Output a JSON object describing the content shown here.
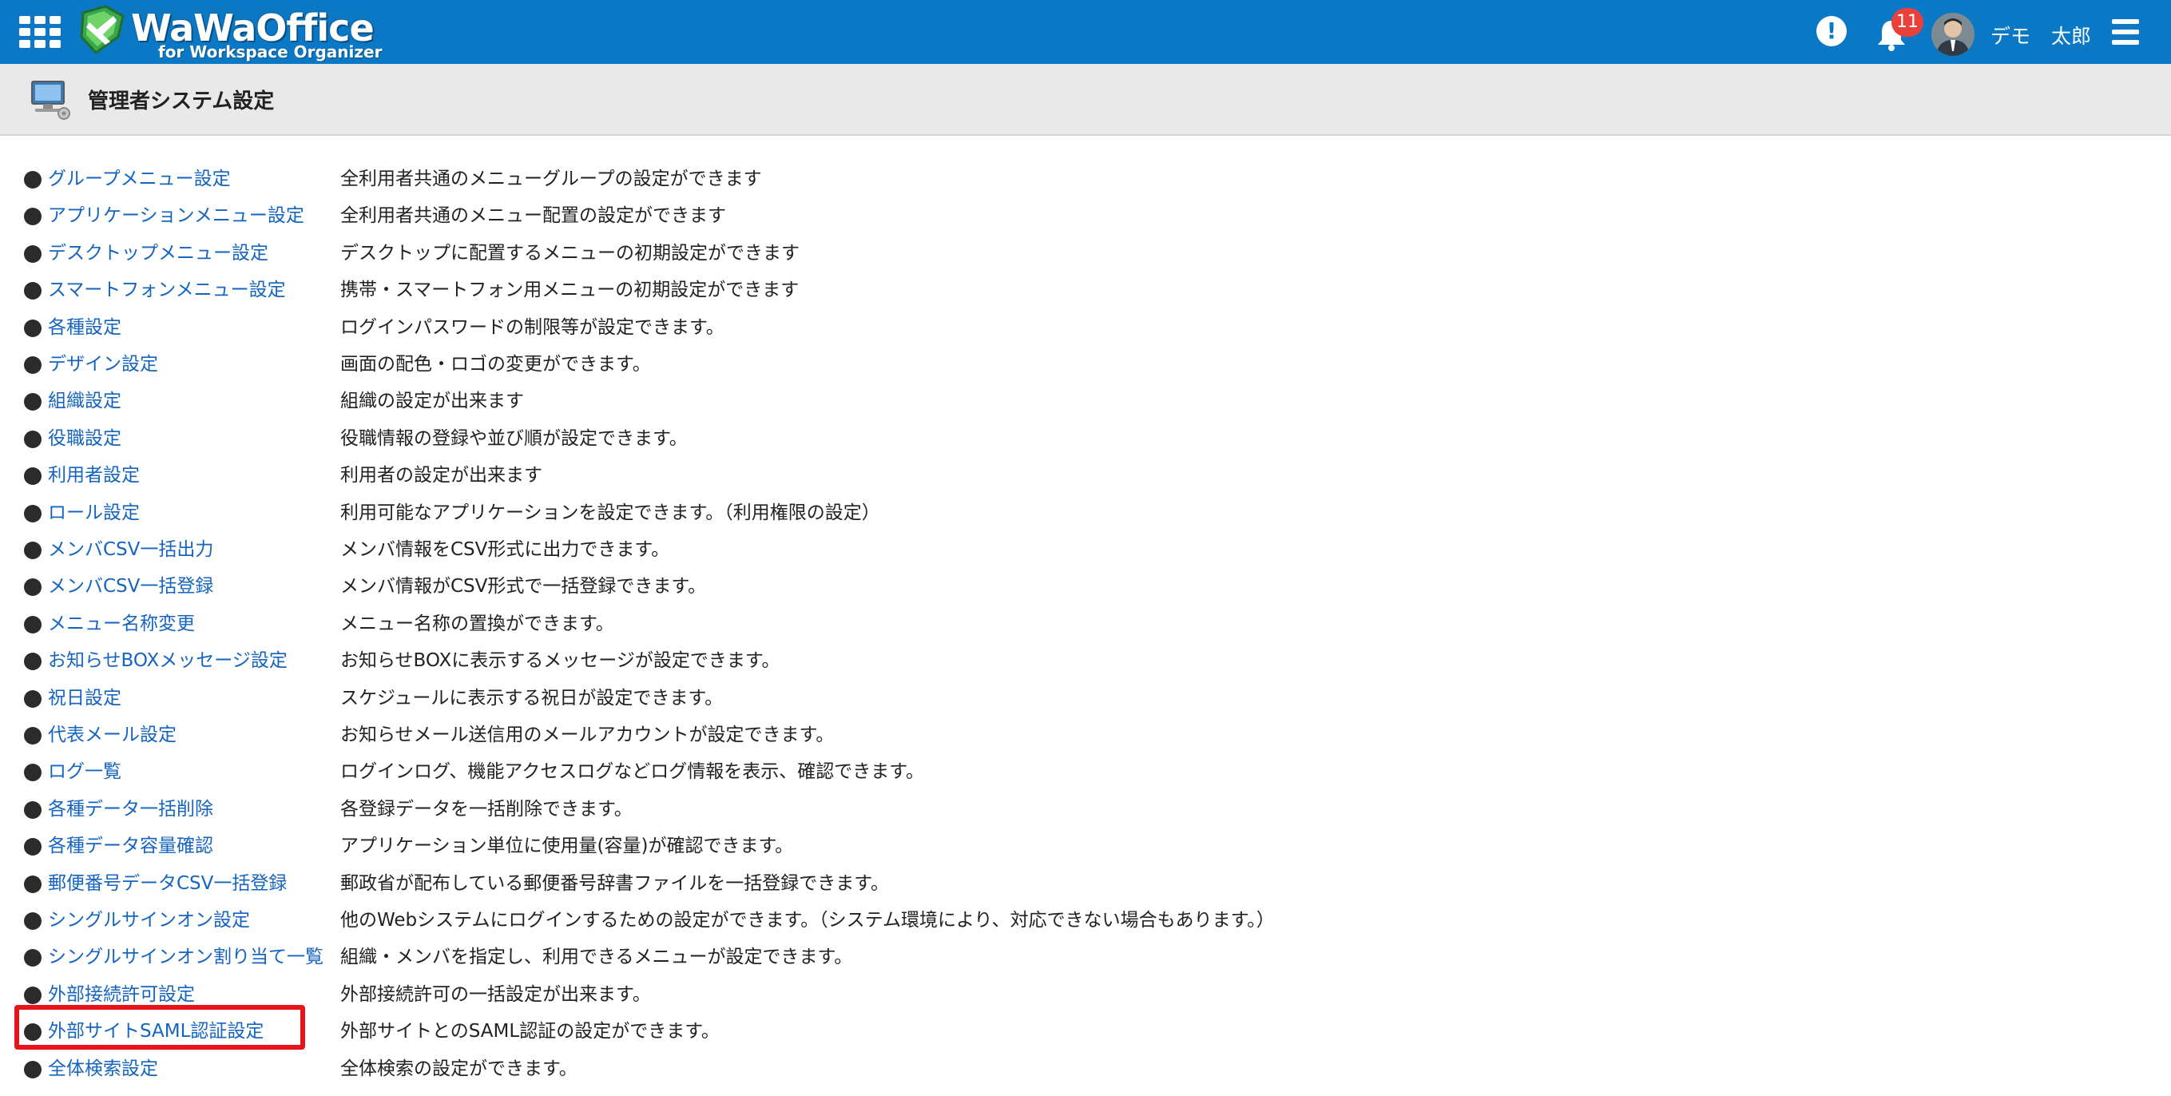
{
  "header": {
    "logo_text": "WaWaOffice",
    "logo_subtitle": "for Workspace Organizer",
    "notification_count": "11",
    "user_name": "デモ 太郎"
  },
  "page": {
    "title": "管理者システム設定"
  },
  "settings": [
    {
      "label": "グループメニュー設定",
      "description": "全利用者共通のメニューグループの設定ができます"
    },
    {
      "label": "アプリケーションメニュー設定",
      "description": "全利用者共通のメニュー配置の設定ができます"
    },
    {
      "label": "デスクトップメニュー設定",
      "description": "デスクトップに配置するメニューの初期設定ができます"
    },
    {
      "label": "スマートフォンメニュー設定",
      "description": "携帯・スマートフォン用メニューの初期設定ができます"
    },
    {
      "label": "各種設定",
      "description": "ログインパスワードの制限等が設定できます。"
    },
    {
      "label": "デザイン設定",
      "description": "画面の配色・ロゴの変更ができます。"
    },
    {
      "label": "組織設定",
      "description": "組織の設定が出来ます"
    },
    {
      "label": "役職設定",
      "description": "役職情報の登録や並び順が設定できます。"
    },
    {
      "label": "利用者設定",
      "description": "利用者の設定が出来ます"
    },
    {
      "label": "ロール設定",
      "description": "利用可能なアプリケーションを設定できます。（利用権限の設定）"
    },
    {
      "label": "メンバCSV一括出力",
      "description": "メンバ情報をCSV形式に出力できます。"
    },
    {
      "label": "メンバCSV一括登録",
      "description": "メンバ情報がCSV形式で一括登録できます。"
    },
    {
      "label": "メニュー名称変更",
      "description": "メニュー名称の置換ができます。"
    },
    {
      "label": "お知らせBOXメッセージ設定",
      "description": "お知らせBOXに表示するメッセージが設定できます。"
    },
    {
      "label": "祝日設定",
      "description": "スケジュールに表示する祝日が設定できます。"
    },
    {
      "label": "代表メール設定",
      "description": "お知らせメール送信用のメールアカウントが設定できます。"
    },
    {
      "label": "ログ一覧",
      "description": "ログインログ、機能アクセスログなどログ情報を表示、確認できます。"
    },
    {
      "label": "各種データ一括削除",
      "description": "各登録データを一括削除できます。"
    },
    {
      "label": "各種データ容量確認",
      "description": "アプリケーション単位に使用量(容量)が確認できます。"
    },
    {
      "label": "郵便番号データCSV一括登録",
      "description": "郵政省が配布している郵便番号辞書ファイルを一括登録できます。"
    },
    {
      "label": "シングルサインオン設定",
      "description": "他のWebシステムにログインするための設定ができます。（システム環境により、対応できない場合もあります。）"
    },
    {
      "label": "シングルサインオン割り当て一覧",
      "description": "組織・メンバを指定し、利用できるメニューが設定できます。"
    },
    {
      "label": "外部接続許可設定",
      "description": "外部接続許可の一括設定が出来ます。"
    },
    {
      "label": "外部サイトSAML認証設定",
      "description": "外部サイトとのSAML認証の設定ができます。"
    },
    {
      "label": "全体検索設定",
      "description": "全体検索の設定ができます。"
    }
  ],
  "colors": {
    "topbar": "#0a78c4",
    "link": "#1565c0",
    "badge": "#e8413c",
    "highlight": "#e8141a",
    "header_bg": "#e9e9e9"
  },
  "icons": [
    "apps-grid-icon",
    "wawaoffice-logo-icon",
    "alert-icon",
    "bell-icon",
    "hamburger-menu-icon",
    "computer-settings-icon",
    "bullet-icon"
  ]
}
